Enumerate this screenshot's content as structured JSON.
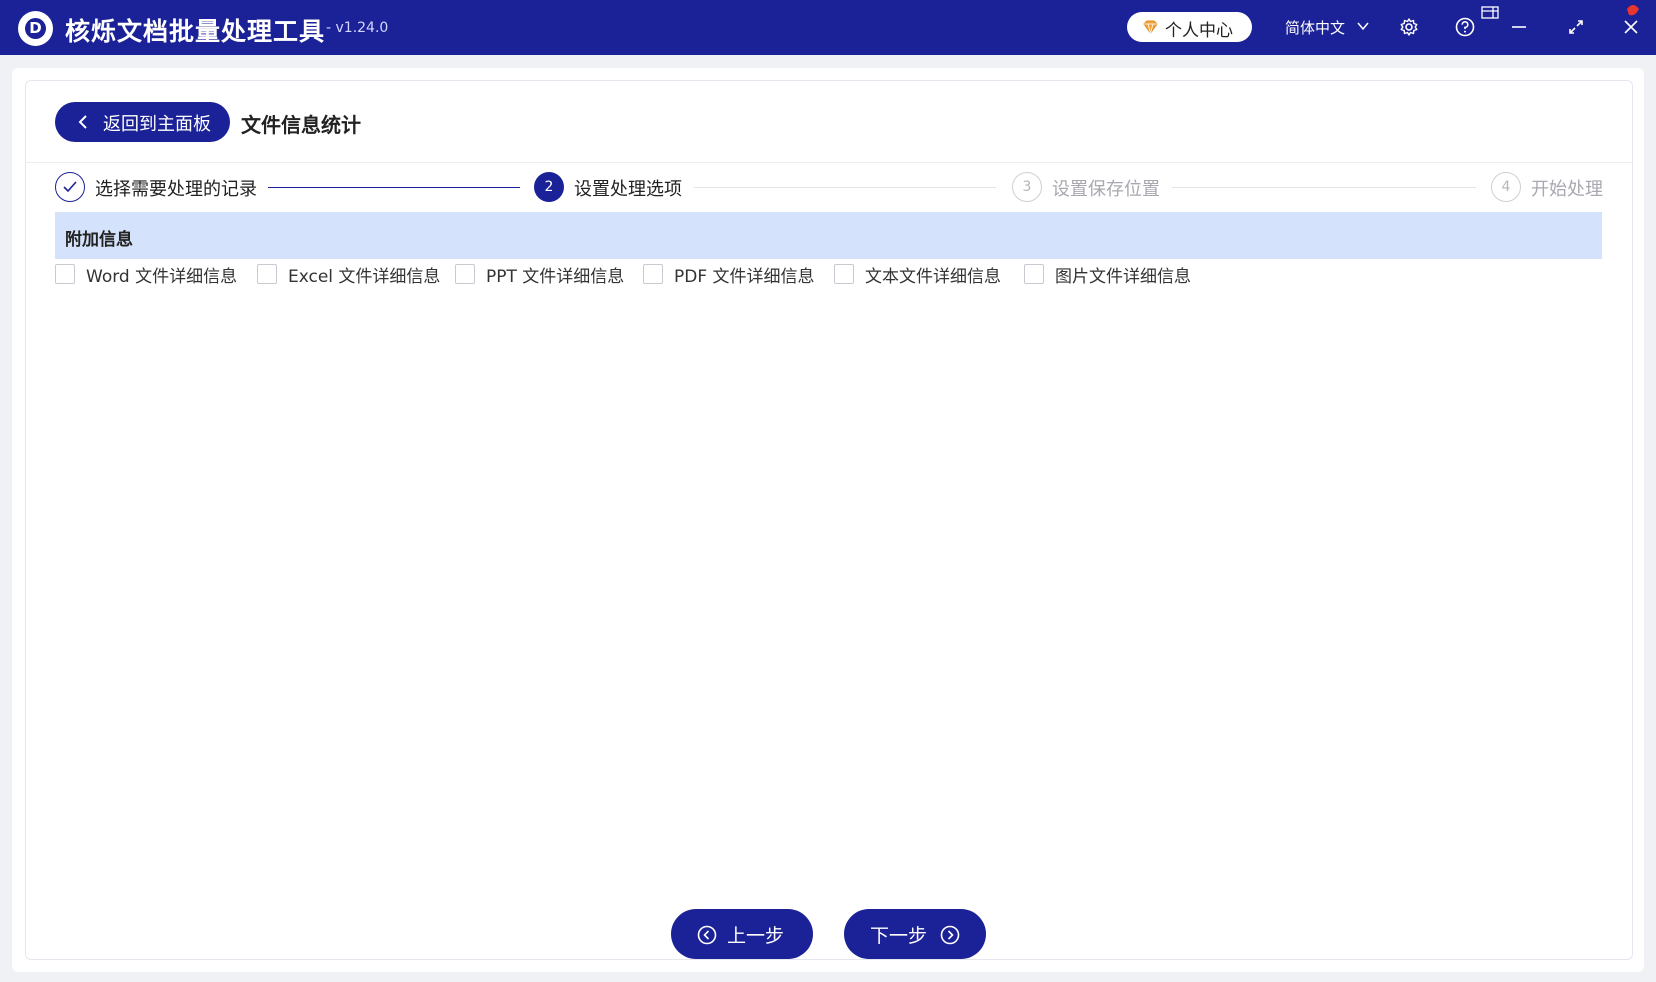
{
  "app": {
    "title": "核烁文档批量处理工具",
    "version": "- v1.24.0",
    "logo_letter": "D",
    "personal_center": "个人中心",
    "language": "简体中文",
    "brand_color": "#1b2196"
  },
  "header": {
    "back_label": "返回到主面板",
    "page_title": "文件信息统计"
  },
  "steps": [
    {
      "number": "✓",
      "label": "选择需要处理的记录",
      "state": "done"
    },
    {
      "number": "2",
      "label": "设置处理选项",
      "state": "active"
    },
    {
      "number": "3",
      "label": "设置保存位置",
      "state": "pending"
    },
    {
      "number": "4",
      "label": "开始处理",
      "state": "pending"
    }
  ],
  "section": {
    "title": "附加信息",
    "options": [
      {
        "label": "Word 文件详细信息",
        "checked": false
      },
      {
        "label": "Excel 文件详细信息",
        "checked": false
      },
      {
        "label": "PPT 文件详细信息",
        "checked": false
      },
      {
        "label": "PDF 文件详细信息",
        "checked": false
      },
      {
        "label": "文本文件详细信息",
        "checked": false
      },
      {
        "label": "图片文件详细信息",
        "checked": false
      }
    ]
  },
  "footer": {
    "prev_label": "上一步",
    "next_label": "下一步"
  }
}
